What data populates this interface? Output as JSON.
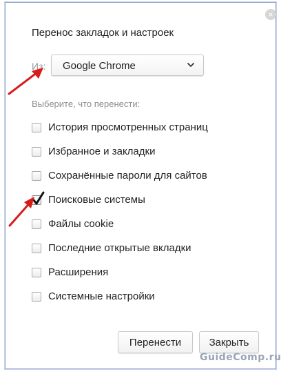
{
  "dialog": {
    "title": "Перенос закладок и настроек",
    "close_glyph": "×",
    "from_label": "Из:",
    "browser_select": {
      "value": "Google Chrome"
    },
    "section_label": "Выберите, что перенести:",
    "options": [
      {
        "label": "История просмотренных страниц",
        "checked": false
      },
      {
        "label": "Избранное и закладки",
        "checked": false
      },
      {
        "label": "Сохранённые пароли для сайтов",
        "checked": false
      },
      {
        "label": "Поисковые системы",
        "checked": true
      },
      {
        "label": "Файлы cookie",
        "checked": false
      },
      {
        "label": "Последние открытые вкладки",
        "checked": false
      },
      {
        "label": "Расширения",
        "checked": false
      },
      {
        "label": "Системные настройки",
        "checked": false
      }
    ],
    "buttons": {
      "transfer": "Перенести",
      "close": "Закрыть"
    }
  },
  "watermark": "GuideComp.ru",
  "colors": {
    "annotation_arrow": "#d81b1b",
    "dialog_border": "#8ea3c8"
  },
  "icons": {
    "select_arrow": "chevron-down-icon",
    "check": "checkmark-icon",
    "close": "close-icon"
  }
}
